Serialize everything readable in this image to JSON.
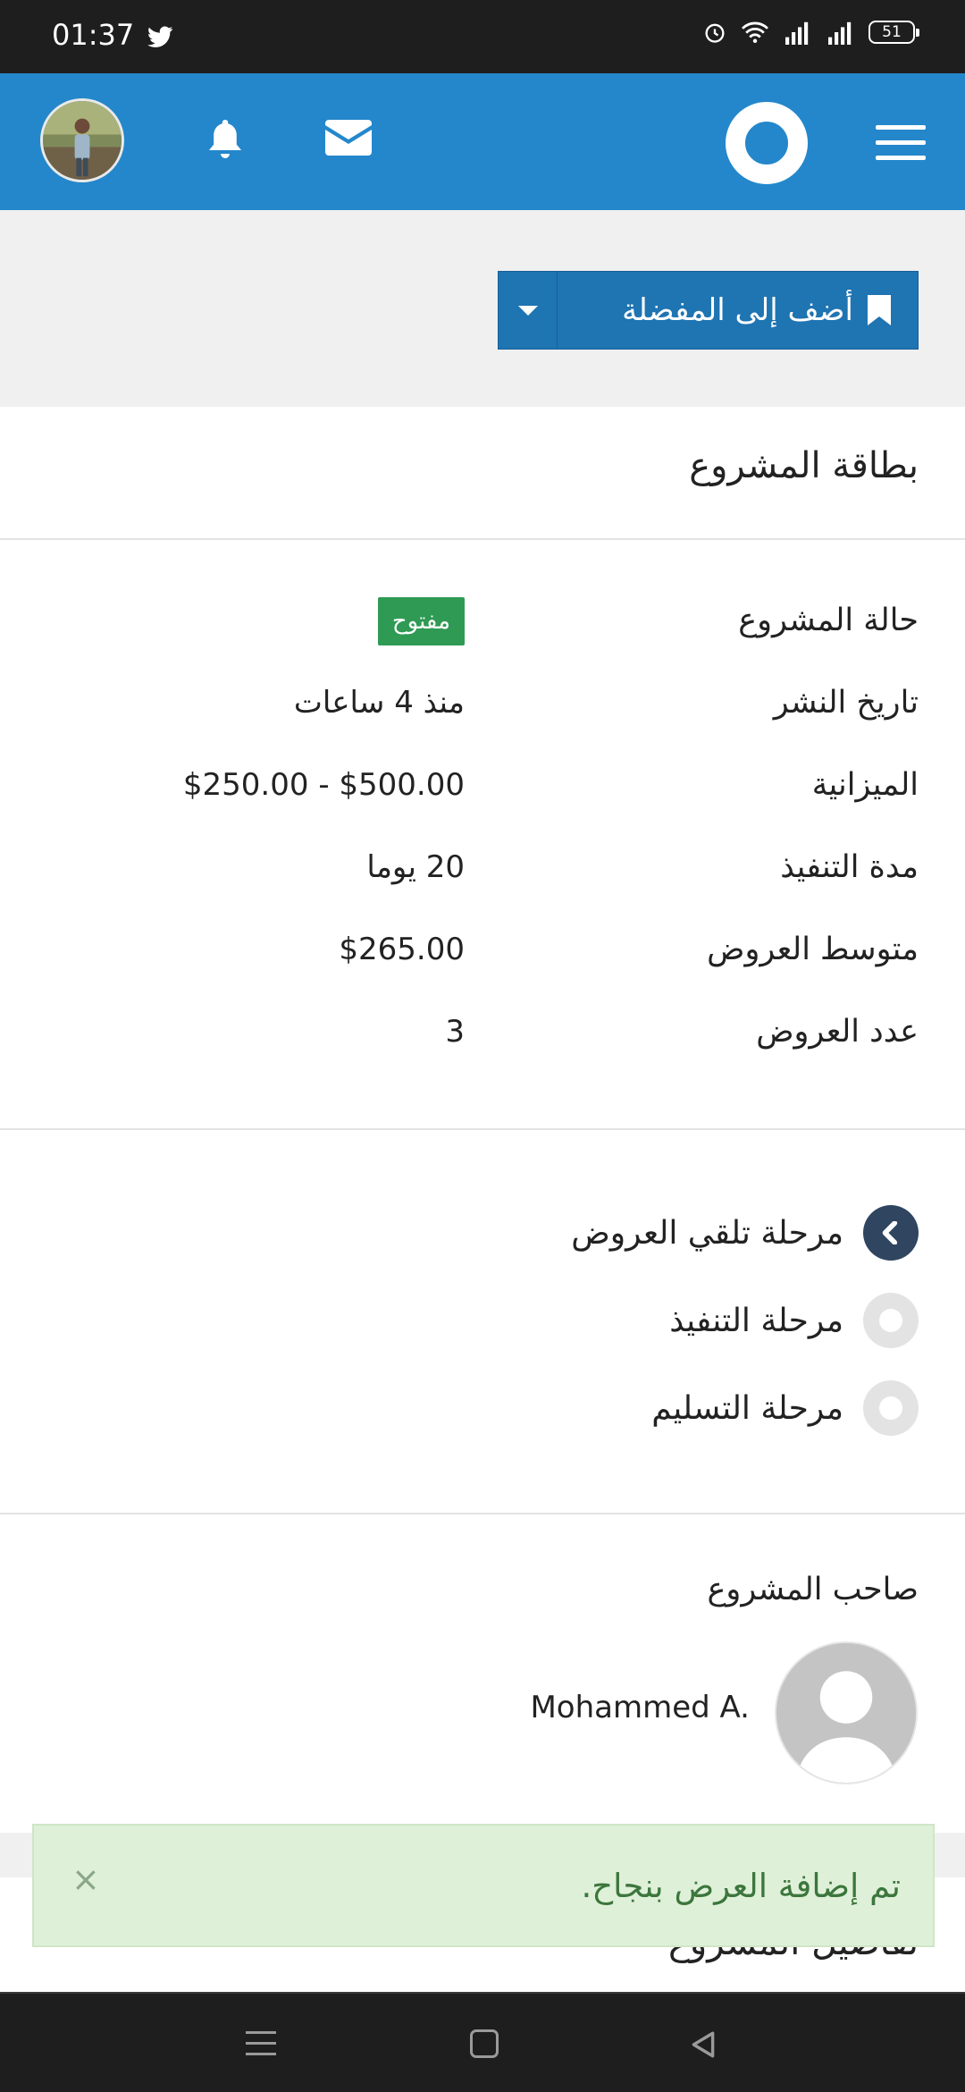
{
  "status_bar": {
    "time": "01:37",
    "battery": "51"
  },
  "header": {
    "icons": {
      "notifications": "bell-icon",
      "messages": "envelope-icon",
      "logo": "ring-logo",
      "menu": "hamburger-icon"
    },
    "accent_color": "#2487cb"
  },
  "favorites": {
    "button_label": "أضف إلى المفضلة"
  },
  "project_card": {
    "title": "بطاقة المشروع",
    "rows": [
      {
        "label": "حالة المشروع",
        "value": "مفتوح",
        "type": "badge"
      },
      {
        "label": "تاريخ النشر",
        "value": "منذ 4 ساعات"
      },
      {
        "label": "الميزانية",
        "value": "$250.00 - $500.00"
      },
      {
        "label": "مدة التنفيذ",
        "value": "20 يوما"
      },
      {
        "label": "متوسط العروض",
        "value": "$265.00"
      },
      {
        "label": "عدد العروض",
        "value": "3"
      }
    ],
    "badge_color": "#2e9a54"
  },
  "stages": [
    {
      "label": "مرحلة تلقي العروض",
      "active": true
    },
    {
      "label": "مرحلة التنفيذ",
      "active": false
    },
    {
      "label": "مرحلة التسليم",
      "active": false
    }
  ],
  "owner": {
    "title": "صاحب المشروع",
    "name": "Mohammed A."
  },
  "next_section": {
    "title": "تفاصيل المشروع"
  },
  "toast": {
    "message": "تم إضافة العرض بنجاح.",
    "close": "×"
  }
}
